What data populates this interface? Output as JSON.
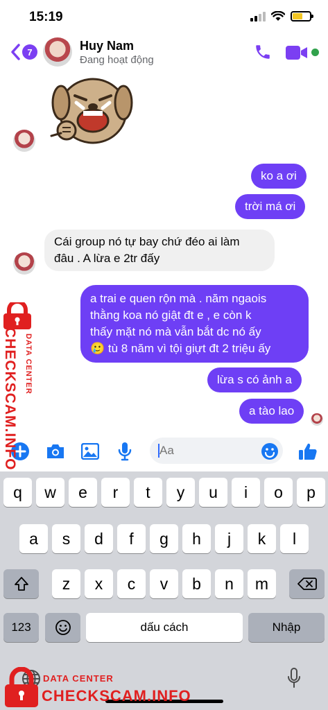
{
  "status_bar": {
    "time": "15:19",
    "battery_level": 0.6
  },
  "header": {
    "back_badge": "7",
    "contact_name": "Huy Nam",
    "contact_status": "Đang hoạt động"
  },
  "messages": [
    {
      "direction": "in",
      "type": "sticker",
      "icon": "crying-dog-sticker"
    },
    {
      "direction": "out",
      "text": "ko a ơi"
    },
    {
      "direction": "out",
      "text": "trời má ơi"
    },
    {
      "direction": "in",
      "lines": [
        "Cái group nó tự bay chứ đéo ai làm",
        "đâu . A lừa e 2tr đấy"
      ]
    },
    {
      "direction": "out",
      "lines": [
        "a trai e quen rộn mà . năm ngaois",
        "thằng koa nó giật đt e , e còn k",
        "thấy mặt nó mà vẫn bắt dc nó ấy",
        "🥲 tù 8 năm vì tội giựt đt 2 triệu ấy"
      ]
    },
    {
      "direction": "out",
      "text": "lừa s có ảnh a"
    },
    {
      "direction": "out",
      "text": "a tào lao"
    }
  ],
  "composer": {
    "placeholder": "Aa",
    "icons": [
      "plus-icon",
      "camera-icon",
      "gallery-icon",
      "microphone-icon",
      "emoji-icon",
      "thumbs-up-icon"
    ]
  },
  "keyboard": {
    "row1": [
      "q",
      "w",
      "e",
      "r",
      "t",
      "y",
      "u",
      "i",
      "o",
      "p"
    ],
    "row2": [
      "a",
      "s",
      "d",
      "f",
      "g",
      "h",
      "j",
      "k",
      "l"
    ],
    "row3": [
      "z",
      "x",
      "c",
      "v",
      "b",
      "n",
      "m"
    ],
    "numbers_key": "123",
    "space_key": "dấu cách",
    "return_key": "Nhập"
  },
  "watermark": {
    "line1": "DATA CENTER",
    "line2": "CHECKSCAM.INFO"
  },
  "colors": {
    "accent": "#7b3ff2",
    "outgoing_bubble": "#6e3ff5",
    "incoming_bubble": "#f0f0f0",
    "online": "#31a24c",
    "icon_blue": "#1877f2",
    "watermark": "#e02020"
  }
}
